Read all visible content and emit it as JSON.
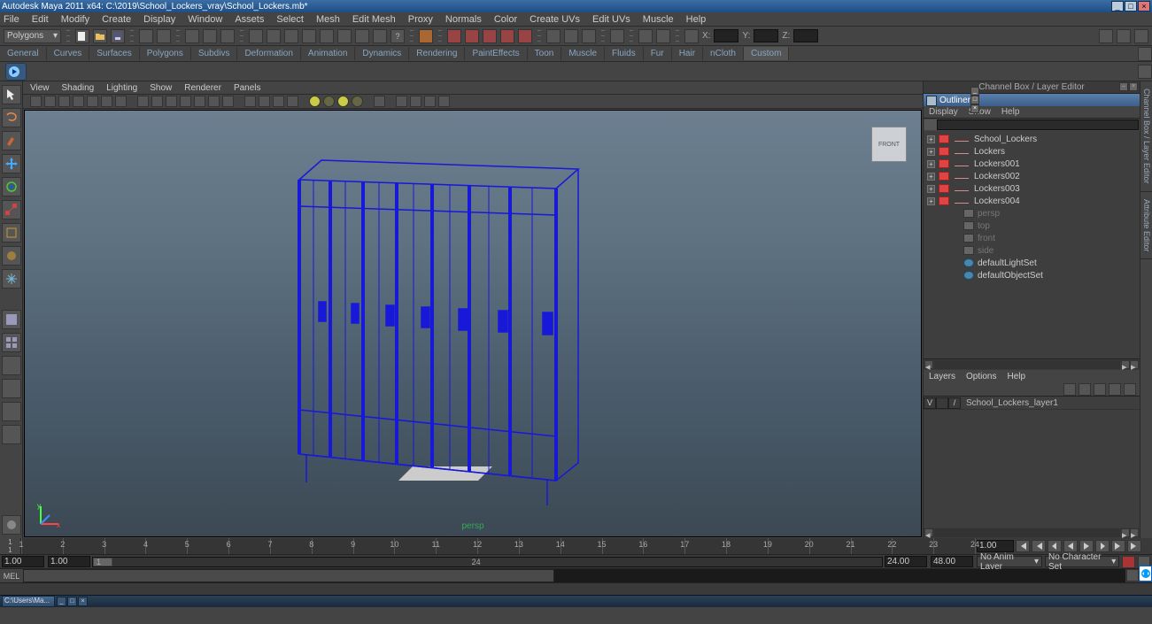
{
  "title": "Autodesk Maya 2011 x64: C:\\2019\\School_Lockers_vray\\School_Lockers.mb*",
  "menus": [
    "File",
    "Edit",
    "Modify",
    "Create",
    "Display",
    "Window",
    "Assets",
    "Select",
    "Mesh",
    "Edit Mesh",
    "Proxy",
    "Normals",
    "Color",
    "Create UVs",
    "Edit UVs",
    "Muscle",
    "Help"
  ],
  "module_dropdown": "Polygons",
  "coord_labels": {
    "x": "X:",
    "y": "Y:",
    "z": "Z:"
  },
  "shelves": [
    "General",
    "Curves",
    "Surfaces",
    "Polygons",
    "Subdivs",
    "Deformation",
    "Animation",
    "Dynamics",
    "Rendering",
    "PaintEffects",
    "Toon",
    "Muscle",
    "Fluids",
    "Fur",
    "Hair",
    "nCloth",
    "Custom"
  ],
  "active_shelf": "Custom",
  "view_tabs": [
    "View",
    "Shading",
    "Lighting",
    "Show",
    "Renderer",
    "Panels"
  ],
  "view_cube_face": "FRONT",
  "camera_name": "persp",
  "side_tabs": [
    "Channel Box / Layer Editor",
    "Attribute Editor"
  ],
  "panel_title_top": "Channel Box / Layer Editor",
  "outliner": {
    "title": "Outliner",
    "menus": [
      "Display",
      "Show",
      "Help"
    ],
    "search_placeholder": "",
    "nodes": [
      {
        "exp": true,
        "icon": "mesh",
        "name": "School_Lockers",
        "swatch": true
      },
      {
        "exp": true,
        "icon": "mesh",
        "name": "Lockers",
        "swatch": true
      },
      {
        "exp": true,
        "icon": "mesh",
        "name": "Lockers001",
        "swatch": true
      },
      {
        "exp": true,
        "icon": "mesh",
        "name": "Lockers002",
        "swatch": true
      },
      {
        "exp": true,
        "icon": "mesh",
        "name": "Lockers003",
        "swatch": true
      },
      {
        "exp": true,
        "icon": "mesh",
        "name": "Lockers004",
        "swatch": true
      },
      {
        "exp": false,
        "icon": "cam",
        "name": "persp",
        "dim": true
      },
      {
        "exp": false,
        "icon": "cam",
        "name": "top",
        "dim": true
      },
      {
        "exp": false,
        "icon": "cam",
        "name": "front",
        "dim": true
      },
      {
        "exp": false,
        "icon": "cam",
        "name": "side",
        "dim": true
      },
      {
        "exp": false,
        "icon": "set",
        "name": "defaultLightSet"
      },
      {
        "exp": false,
        "icon": "set",
        "name": "defaultObjectSet"
      }
    ]
  },
  "layers": {
    "menus": [
      "Layers",
      "Options",
      "Help"
    ],
    "rows": [
      {
        "vis": "V",
        "name": "School_Lockers_layer1"
      }
    ]
  },
  "time": {
    "start_outer": "1",
    "start_inner": "1",
    "end_inner": "24",
    "end_outer": "48",
    "cur": "1.00",
    "anim_layer": "No Anim Layer",
    "char_set": "No Character Set",
    "range_start": "1.00",
    "range_start2": "1.00",
    "range_marker": "1",
    "range_marker2": "24",
    "range_end": "24.00",
    "range_end2": "48.00"
  },
  "cmd_label": "MEL",
  "taskbar_item": "C:\\Users\\Ma..."
}
